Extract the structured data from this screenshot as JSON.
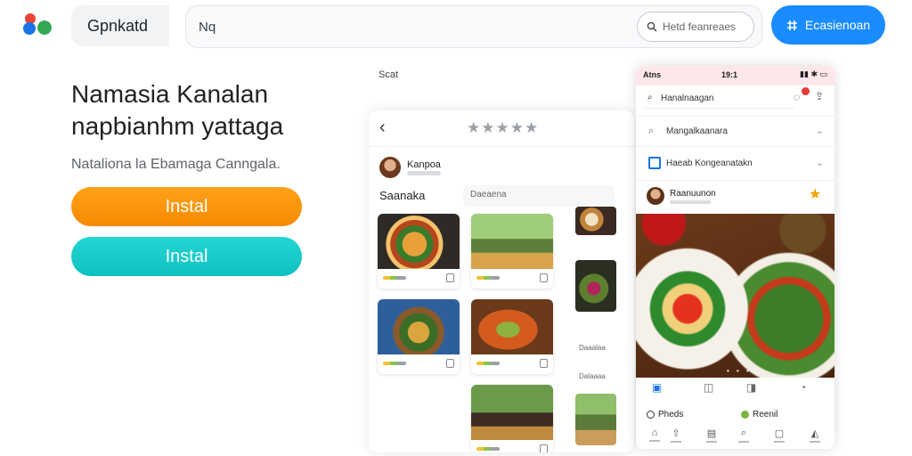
{
  "header": {
    "brand": "Gpnkatd",
    "search_text": "Nq",
    "search_pill": "Hetd feanreaes",
    "cta_label": "Ecasienoan"
  },
  "hero": {
    "title": "Namasia Kanalan napbianhm yattaga",
    "subtitle": "Nataliona la Ebamaga Canngala.",
    "install_primary": "Instal",
    "install_secondary": "Instal"
  },
  "column_label": "Scat",
  "tablet": {
    "rating_stars": "★★★★★",
    "user_name": "Kanpoa",
    "section_label": "Saanaka",
    "field_text": "Daeaena",
    "side_labels": [
      "Daaalaa",
      "Dalaaaa"
    ]
  },
  "phone": {
    "status": {
      "carrier": "Atns",
      "time": "19:1"
    },
    "search_text": "Hanalnaagan",
    "rows": [
      {
        "label": "Mangalkaanara"
      },
      {
        "label": "Haeab Kongeanatakn"
      }
    ],
    "user_name": "Raanuunon",
    "chips": [
      "Pheds",
      "Reenil"
    ]
  },
  "colors": {
    "install_primary": "#f68a00",
    "install_secondary": "#14c4c4",
    "cta": "#1a8cff",
    "favorite_star": "#f2a200"
  }
}
